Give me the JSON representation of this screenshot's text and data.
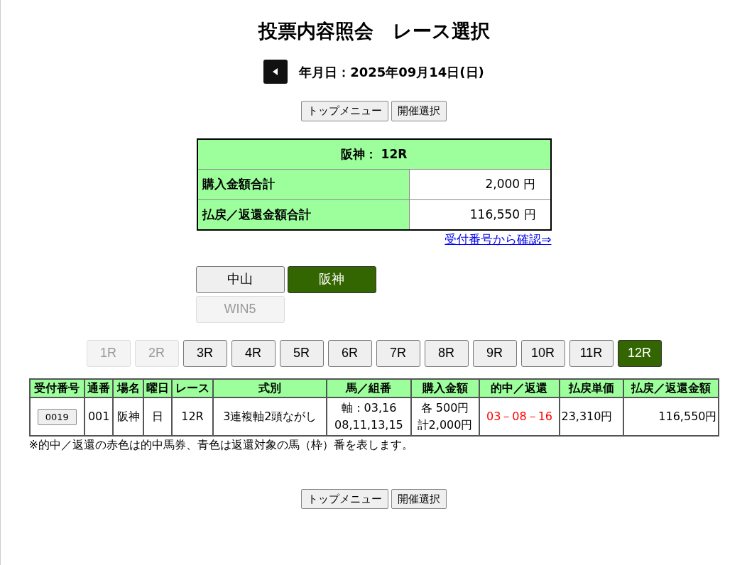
{
  "title": "投票内容照会　レース選択",
  "date_nav": {
    "label": "年月日：2025年09月14日(日)"
  },
  "top_buttons": [
    "トップメニュー",
    "開催選択"
  ],
  "summary": {
    "heading": "阪神： 12R",
    "rows": [
      {
        "label": "購入金額合計",
        "value": "2,000 円"
      },
      {
        "label": "払戻／返還金額合計",
        "value": "116,550 円"
      }
    ]
  },
  "receipt_link": "受付番号から確認⇒",
  "venues": [
    {
      "label": "中山",
      "selected": false,
      "disabled": false
    },
    {
      "label": "阪神",
      "selected": true,
      "disabled": false
    },
    {
      "label": "WIN5",
      "selected": false,
      "disabled": true
    }
  ],
  "races": [
    {
      "label": "1R",
      "selected": false,
      "disabled": true
    },
    {
      "label": "2R",
      "selected": false,
      "disabled": true
    },
    {
      "label": "3R",
      "selected": false,
      "disabled": false
    },
    {
      "label": "4R",
      "selected": false,
      "disabled": false
    },
    {
      "label": "5R",
      "selected": false,
      "disabled": false
    },
    {
      "label": "6R",
      "selected": false,
      "disabled": false
    },
    {
      "label": "7R",
      "selected": false,
      "disabled": false
    },
    {
      "label": "8R",
      "selected": false,
      "disabled": false
    },
    {
      "label": "9R",
      "selected": false,
      "disabled": false
    },
    {
      "label": "10R",
      "selected": false,
      "disabled": false
    },
    {
      "label": "11R",
      "selected": false,
      "disabled": false
    },
    {
      "label": "12R",
      "selected": true,
      "disabled": false
    }
  ],
  "table": {
    "columns": [
      "受付番号",
      "通番",
      "場名",
      "曜日",
      "レース",
      "式別",
      "馬／組番",
      "購入金額",
      "的中／返還",
      "払戻単価",
      "払戻／返還金額"
    ],
    "rows": [
      {
        "receipt": "0019",
        "serial": "001",
        "venue": "阪神",
        "day": "日",
        "race": "12R",
        "bet_type": "3連複軸2頭ながし",
        "horses": [
          "軸：03,16",
          "08,11,13,15"
        ],
        "amount": [
          "各 500円",
          "計2,000円"
        ],
        "result": {
          "text": "03－08－16",
          "kind": "hit"
        },
        "unit_payout": "23,310円",
        "payout": "116,550円"
      }
    ]
  },
  "note": "※的中／返還の赤色は的中馬券、青色は返還対象の馬（枠）番を表します。",
  "bottom_buttons": [
    "トップメニュー",
    "開催選択"
  ]
}
